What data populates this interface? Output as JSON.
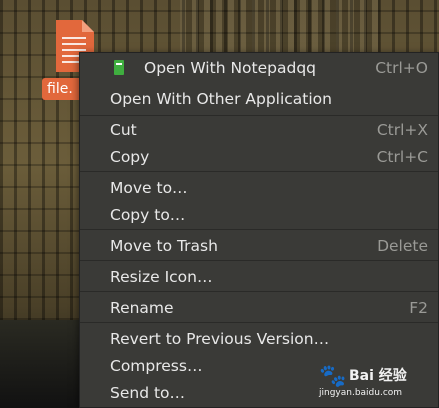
{
  "desktop": {
    "file_label": "file."
  },
  "menu": {
    "items": [
      {
        "label": "Open With Notepadqq",
        "shortcut": "Ctrl+O"
      },
      {
        "label": "Open With Other Application",
        "shortcut": ""
      },
      {
        "label": "Cut",
        "shortcut": "Ctrl+X"
      },
      {
        "label": "Copy",
        "shortcut": "Ctrl+C"
      },
      {
        "label": "Move to…",
        "shortcut": ""
      },
      {
        "label": "Copy to…",
        "shortcut": ""
      },
      {
        "label": "Move to Trash",
        "shortcut": "Delete"
      },
      {
        "label": "Resize Icon…",
        "shortcut": ""
      },
      {
        "label": "Rename",
        "shortcut": "F2"
      },
      {
        "label": "Revert to Previous Version…",
        "shortcut": ""
      },
      {
        "label": "Compress…",
        "shortcut": ""
      },
      {
        "label": "Send to…",
        "shortcut": ""
      }
    ]
  },
  "watermark": {
    "brand": "Bai 经验",
    "url": "jingyan.baidu.com"
  },
  "colors": {
    "menu_bg": "#3a3a37",
    "file_accent": "#e2683c",
    "app_icon": "#3fae3f"
  },
  "icons": [
    "file-icon",
    "notepadqq-icon",
    "baidu-paw-icon"
  ]
}
